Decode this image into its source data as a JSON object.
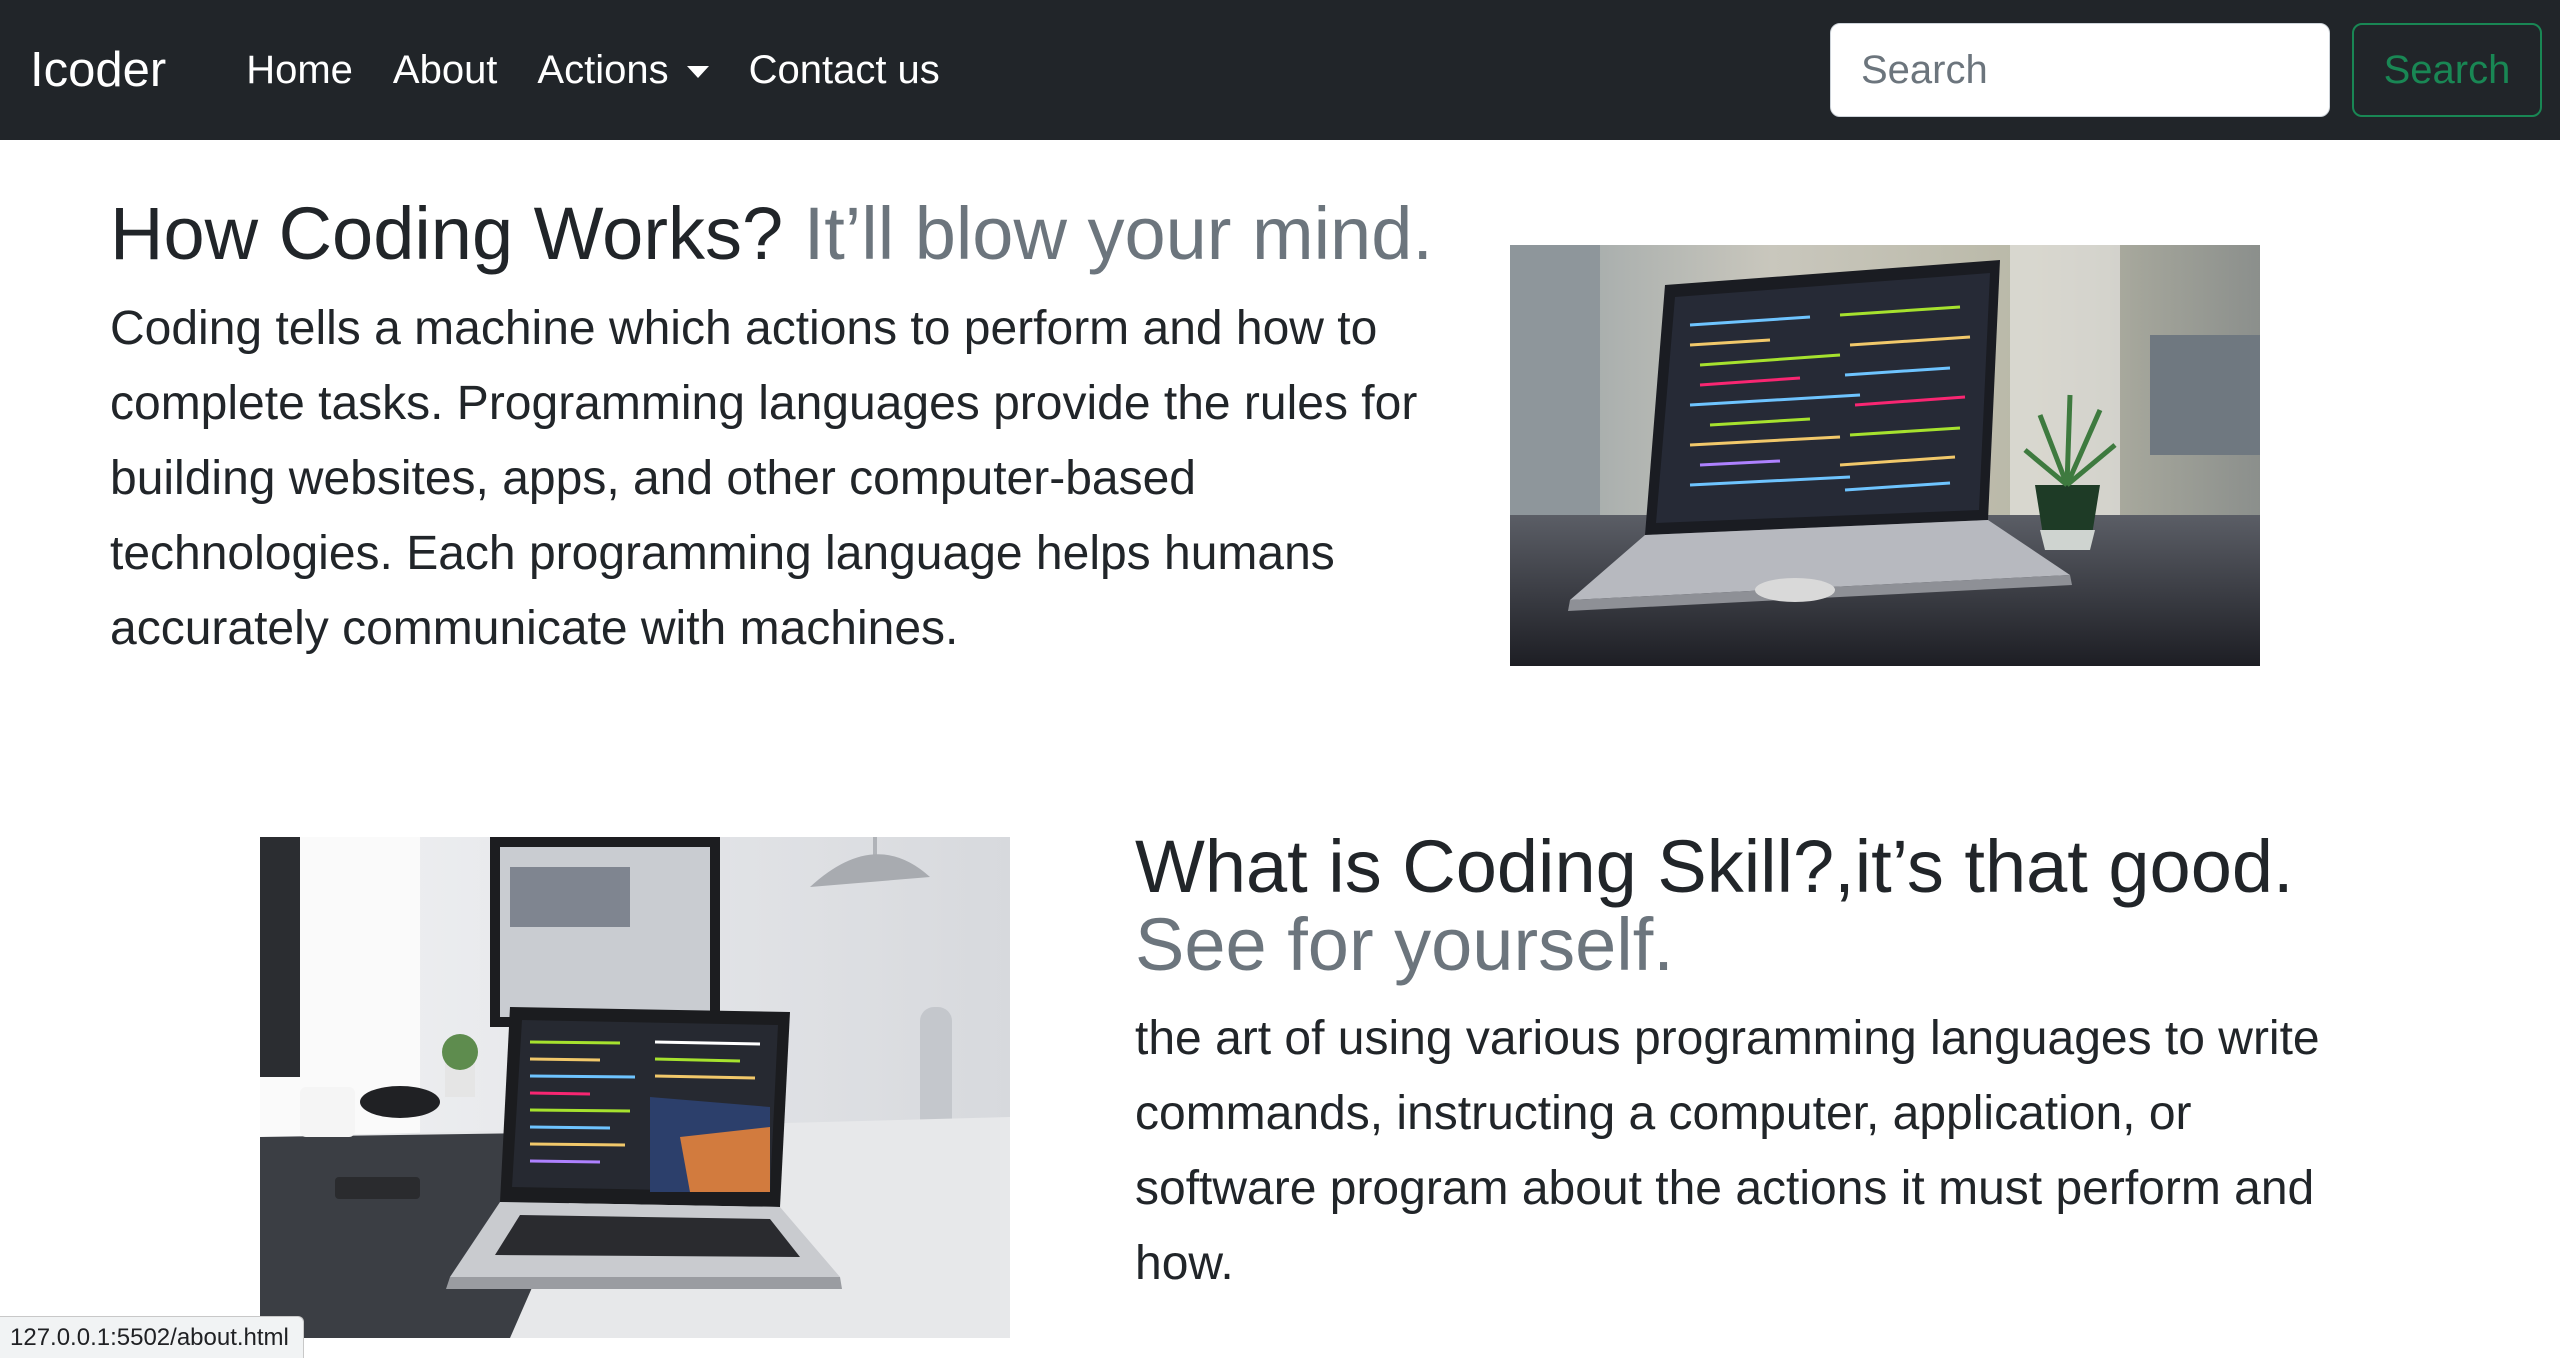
{
  "navbar": {
    "brand": "Icoder",
    "links": [
      "Home",
      "About",
      "Actions",
      "Contact us"
    ],
    "search": {
      "placeholder": "Search",
      "button_label": "Search"
    }
  },
  "featurette1": {
    "heading": "How Coding Works?",
    "heading_muted": "It’ll blow your mind.",
    "lead": "Coding tells a machine which actions to perform and how to complete tasks. Programming languages provide the rules for building websites, apps, and other computer-based technologies. Each programming language helps humans accurately communicate with machines."
  },
  "featurette2": {
    "heading": "What is Coding Skill?,it’s that good.",
    "heading_muted": "See for yourself.",
    "lead": "the art of using various programming languages to write commands, instructing a computer, application, or software program about the actions it must perform and how."
  },
  "status_bar": {
    "url": "127.0.0.1:5502/about.html"
  },
  "colors": {
    "navbar_bg": "#212529",
    "success": "#198754",
    "muted": "#6c757d"
  }
}
